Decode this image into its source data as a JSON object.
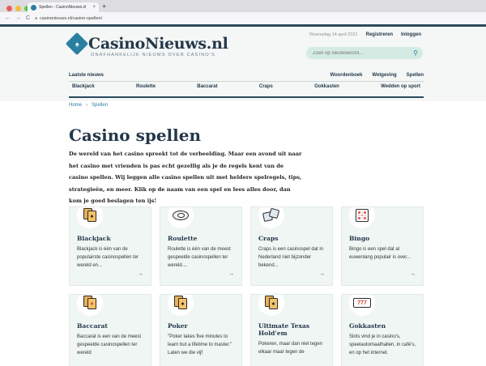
{
  "browser": {
    "tab_title": "Spellen - CasinoNieuws.nl",
    "tab_close": "×",
    "new_tab": "+",
    "back": "←",
    "forward": "→",
    "reload": "C",
    "url": "casinonieuws.nl/casino-spellen/"
  },
  "header": {
    "logo_mark": "♠",
    "logo_text": "CasinoNieuws.nl",
    "tagline": "ONAFHANKELIJK NIEUWS OVER CASINO'S",
    "date": "Woensdag 14 april 2021",
    "register": "Registreren",
    "login": "Inloggen",
    "search_placeholder": "Zoek op sleutelwoord...",
    "search_icon": "⚲"
  },
  "nav": {
    "latest": "Laatste nieuws",
    "right": [
      "Woordenboek",
      "Wetgeving",
      "Spellen"
    ],
    "games": [
      "Blackjack",
      "Roulette",
      "Baccarat",
      "Craps",
      "Gokkasten",
      "Wedden op sport"
    ]
  },
  "breadcrumb": {
    "home": "Home",
    "sep": "›",
    "current": "Spellen"
  },
  "main": {
    "title": "Casino spellen",
    "intro": "De wereld van het casino spreekt tot de verbeelding. Maar een avond uit naar het casino met vrienden is pas echt gezellig als je de regels kent van de casino spellen. Wij leggen alle casino spellen uit met heldere spelregels, tips, strategieën, en meer. Klik op de naam van een spel en lees alles door, dan kom je goed beslagen ten ijs!"
  },
  "cards": [
    {
      "title": "Blackjack",
      "text": "Blackjack is één van de populairste casinospellen ter wereld en...",
      "icon": "cards-spade-icon",
      "glyph": "♠",
      "arrow": "→"
    },
    {
      "title": "Roulette",
      "text": "Roulette is één van de meest gespeelde casinospellen ter wereld....",
      "icon": "roulette-wheel-icon",
      "glyph": "",
      "arrow": "→"
    },
    {
      "title": "Craps",
      "text": "Craps is een casinospel dat in Nederland niet bijzonder bekend...",
      "icon": "dice-icon",
      "glyph": "",
      "arrow": "→"
    },
    {
      "title": "Bingo",
      "text": "Bingo is een spel dat al euwenlang populair is over...",
      "icon": "bingo-card-icon",
      "glyph": "",
      "arrow": "→"
    },
    {
      "title": "Baccarat",
      "text": "Baccarat is een van de meest gespeelde casinospellen ter wereld",
      "icon": "cards-diamond-icon",
      "glyph": "♦",
      "arrow": ""
    },
    {
      "title": "Poker",
      "text": "\"Poker takes five minutes to learn but a lifetime to master.\" Laten we die vijf",
      "icon": "cards-spade-icon",
      "glyph": "♠",
      "arrow": ""
    },
    {
      "title": "Ultimate Texas Hold'em",
      "text": "Pokeren, maar dan niet tegen elkaar maar tegen de",
      "icon": "cards-spade-icon",
      "glyph": "♠",
      "arrow": ""
    },
    {
      "title": "Gokkasten",
      "text": "Slots vind je in casino's, speelautomaathallen, in café's, en op het internet.",
      "icon": "slot-machine-icon",
      "glyph": "777",
      "arrow": ""
    }
  ],
  "colors": {
    "accent": "#2a7fa0",
    "navy": "#24384a",
    "card_bg": "#f0f6f4",
    "search_bg": "#d4ebe3"
  }
}
